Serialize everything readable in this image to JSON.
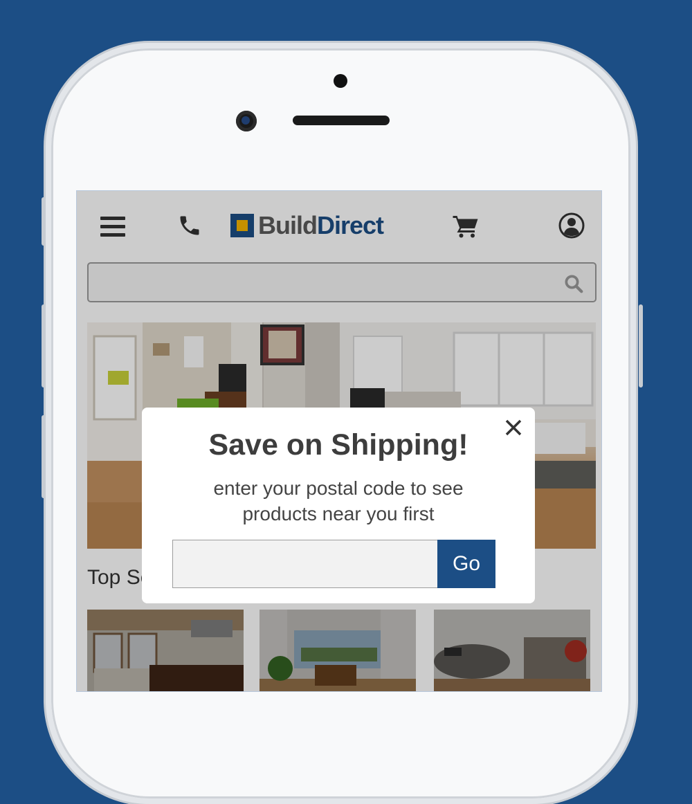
{
  "header": {
    "logo_build": "Build",
    "logo_direct": "Direct",
    "icons": [
      "menu-icon",
      "phone-icon",
      "cart-icon",
      "account-icon"
    ]
  },
  "search": {
    "placeholder": "",
    "icon": "search-icon"
  },
  "main": {
    "section_title": "Top Se"
  },
  "modal": {
    "title": "Save on Shipping!",
    "subtitle": "enter your postal code to see products near you first",
    "postal_placeholder": "",
    "go_label": "Go",
    "close_icon": "close-icon"
  },
  "colors": {
    "brand_blue": "#1c4e85",
    "logo_yellow": "#f5b400",
    "background": "#1c4e85"
  }
}
